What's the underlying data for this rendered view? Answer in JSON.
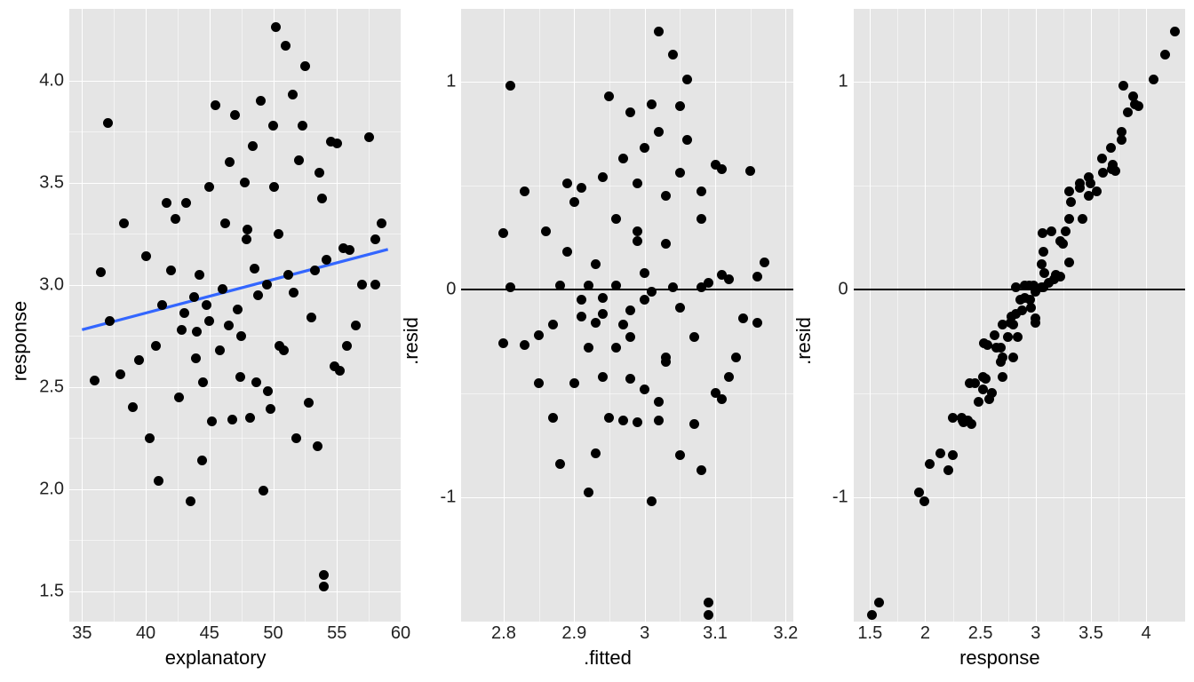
{
  "chart_data": [
    {
      "type": "scatter",
      "xlabel": "explanatory",
      "ylabel": "response",
      "xlim": [
        34,
        60
      ],
      "ylim": [
        1.35,
        4.35
      ],
      "xticks": [
        35,
        40,
        45,
        50,
        55,
        60
      ],
      "yticks": [
        1.5,
        2.0,
        2.5,
        3.0,
        3.5,
        4.0
      ],
      "regression": {
        "slope": 0.0164,
        "intercept": 2.205,
        "x0": 35,
        "x1": 59
      },
      "points": [
        [
          36.0,
          2.53
        ],
        [
          36.5,
          3.06
        ],
        [
          37.0,
          3.79
        ],
        [
          37.2,
          2.82
        ],
        [
          38.0,
          2.56
        ],
        [
          38.3,
          3.3
        ],
        [
          39.5,
          2.63
        ],
        [
          40.0,
          3.14
        ],
        [
          40.3,
          2.25
        ],
        [
          40.8,
          2.7
        ],
        [
          41.0,
          2.04
        ],
        [
          41.3,
          2.9
        ],
        [
          42.0,
          3.07
        ],
        [
          42.3,
          3.32
        ],
        [
          42.6,
          2.45
        ],
        [
          42.8,
          2.78
        ],
        [
          43.0,
          2.86
        ],
        [
          43.2,
          3.4
        ],
        [
          43.5,
          1.94
        ],
        [
          43.8,
          2.94
        ],
        [
          44.0,
          2.77
        ],
        [
          44.2,
          3.05
        ],
        [
          44.5,
          2.52
        ],
        [
          44.8,
          2.9
        ],
        [
          45.0,
          3.48
        ],
        [
          45.2,
          2.33
        ],
        [
          45.5,
          3.88
        ],
        [
          45.8,
          2.68
        ],
        [
          46.0,
          2.98
        ],
        [
          46.2,
          3.3
        ],
        [
          46.5,
          2.8
        ],
        [
          46.8,
          2.34
        ],
        [
          47.0,
          3.83
        ],
        [
          47.2,
          2.88
        ],
        [
          47.5,
          2.75
        ],
        [
          47.8,
          3.5
        ],
        [
          48.0,
          3.27
        ],
        [
          48.2,
          2.35
        ],
        [
          48.5,
          3.08
        ],
        [
          48.8,
          2.95
        ],
        [
          49.0,
          3.9
        ],
        [
          49.2,
          1.99
        ],
        [
          49.5,
          3.0
        ],
        [
          49.8,
          2.39
        ],
        [
          50.0,
          3.78
        ],
        [
          50.2,
          4.26
        ],
        [
          50.5,
          2.7
        ],
        [
          50.8,
          2.68
        ],
        [
          51.0,
          4.17
        ],
        [
          51.2,
          3.05
        ],
        [
          51.5,
          3.93
        ],
        [
          51.8,
          2.25
        ],
        [
          52.0,
          3.61
        ],
        [
          52.3,
          3.78
        ],
        [
          52.5,
          4.07
        ],
        [
          52.8,
          2.42
        ],
        [
          53.0,
          2.84
        ],
        [
          53.3,
          3.07
        ],
        [
          53.5,
          2.21
        ],
        [
          53.8,
          3.42
        ],
        [
          54.0,
          1.58
        ],
        [
          54.0,
          1.52
        ],
        [
          54.2,
          3.12
        ],
        [
          54.5,
          3.7
        ],
        [
          54.8,
          2.6
        ],
        [
          55.0,
          3.69
        ],
        [
          55.2,
          2.58
        ],
        [
          55.5,
          3.18
        ],
        [
          55.8,
          2.7
        ],
        [
          56.0,
          3.17
        ],
        [
          56.5,
          2.8
        ],
        [
          57.0,
          3.0
        ],
        [
          57.5,
          3.72
        ],
        [
          58.0,
          3.22
        ],
        [
          58.0,
          3.0
        ],
        [
          58.5,
          3.3
        ],
        [
          48.7,
          2.52
        ],
        [
          43.9,
          2.64
        ],
        [
          47.4,
          2.55
        ],
        [
          49.6,
          2.48
        ],
        [
          50.4,
          3.25
        ],
        [
          51.6,
          2.96
        ],
        [
          45.0,
          2.82
        ],
        [
          46.6,
          3.6
        ],
        [
          44.4,
          2.14
        ],
        [
          47.9,
          3.22
        ],
        [
          41.6,
          3.4
        ],
        [
          39.0,
          2.4
        ],
        [
          53.6,
          3.55
        ],
        [
          50.1,
          3.48
        ],
        [
          48.4,
          3.68
        ]
      ]
    },
    {
      "type": "scatter",
      "xlabel": ".fitted",
      "ylabel": ".resid",
      "xlim": [
        2.74,
        3.21
      ],
      "ylim": [
        -1.6,
        1.35
      ],
      "xticks": [
        2.8,
        2.9,
        3.0,
        3.1,
        3.2
      ],
      "yticks": [
        -1,
        0,
        1
      ],
      "hline": 0,
      "points": [
        [
          2.8,
          -0.26
        ],
        [
          2.8,
          0.27
        ],
        [
          2.81,
          0.98
        ],
        [
          2.81,
          0.01
        ],
        [
          2.83,
          -0.27
        ],
        [
          2.83,
          0.47
        ],
        [
          2.85,
          -0.22
        ],
        [
          2.86,
          0.28
        ],
        [
          2.87,
          -0.62
        ],
        [
          2.87,
          -0.17
        ],
        [
          2.88,
          -0.84
        ],
        [
          2.88,
          0.02
        ],
        [
          2.89,
          0.18
        ],
        [
          2.9,
          0.42
        ],
        [
          2.9,
          -0.45
        ],
        [
          2.91,
          -0.13
        ],
        [
          2.91,
          -0.05
        ],
        [
          2.91,
          0.49
        ],
        [
          2.92,
          -0.98
        ],
        [
          2.92,
          0.02
        ],
        [
          2.93,
          -0.16
        ],
        [
          2.93,
          0.12
        ],
        [
          2.94,
          -0.42
        ],
        [
          2.94,
          -0.04
        ],
        [
          2.94,
          0.54
        ],
        [
          2.95,
          -0.62
        ],
        [
          2.95,
          0.93
        ],
        [
          2.96,
          -0.28
        ],
        [
          2.96,
          0.02
        ],
        [
          2.96,
          0.34
        ],
        [
          2.97,
          -0.17
        ],
        [
          2.97,
          -0.63
        ],
        [
          2.98,
          0.85
        ],
        [
          2.98,
          -0.1
        ],
        [
          2.98,
          -0.23
        ],
        [
          2.99,
          0.51
        ],
        [
          2.99,
          0.28
        ],
        [
          2.99,
          -0.64
        ],
        [
          3.0,
          0.08
        ],
        [
          3.0,
          -0.05
        ],
        [
          3.01,
          0.89
        ],
        [
          3.01,
          -1.02
        ],
        [
          3.01,
          -0.01
        ],
        [
          3.02,
          -0.63
        ],
        [
          3.02,
          0.76
        ],
        [
          3.02,
          1.24
        ],
        [
          3.03,
          -0.33
        ],
        [
          3.03,
          -0.35
        ],
        [
          3.04,
          1.13
        ],
        [
          3.04,
          0.01
        ],
        [
          3.05,
          0.88
        ],
        [
          3.05,
          -0.8
        ],
        [
          3.05,
          0.56
        ],
        [
          3.06,
          0.72
        ],
        [
          3.06,
          1.01
        ],
        [
          3.07,
          -0.65
        ],
        [
          3.07,
          -0.23
        ],
        [
          3.08,
          0.01
        ],
        [
          3.08,
          -0.87
        ],
        [
          3.08,
          0.34
        ],
        [
          3.09,
          -1.51
        ],
        [
          3.09,
          -1.57
        ],
        [
          3.09,
          0.03
        ],
        [
          3.1,
          0.6
        ],
        [
          3.1,
          -0.5
        ],
        [
          3.11,
          0.58
        ],
        [
          3.11,
          -0.53
        ],
        [
          3.11,
          0.07
        ],
        [
          3.12,
          -0.42
        ],
        [
          3.12,
          0.05
        ],
        [
          3.13,
          -0.33
        ],
        [
          3.14,
          -0.14
        ],
        [
          3.15,
          0.57
        ],
        [
          3.16,
          0.06
        ],
        [
          3.16,
          -0.16
        ],
        [
          3.17,
          0.13
        ],
        [
          3.0,
          -0.48
        ],
        [
          2.92,
          -0.28
        ],
        [
          2.98,
          -0.43
        ],
        [
          3.02,
          -0.54
        ],
        [
          3.03,
          0.22
        ],
        [
          3.05,
          -0.09
        ],
        [
          2.94,
          -0.12
        ],
        [
          2.97,
          0.63
        ],
        [
          2.93,
          -0.79
        ],
        [
          2.99,
          0.23
        ],
        [
          2.89,
          0.51
        ],
        [
          2.85,
          -0.45
        ],
        [
          3.08,
          0.47
        ],
        [
          3.03,
          0.45
        ],
        [
          3.0,
          0.68
        ]
      ]
    },
    {
      "type": "scatter",
      "xlabel": "response",
      "ylabel": ".resid",
      "xlim": [
        1.35,
        4.35
      ],
      "ylim": [
        -1.6,
        1.35
      ],
      "xticks": [
        1.5,
        2.0,
        2.5,
        3.0,
        3.5,
        4.0
      ],
      "yticks": [
        -1,
        0,
        1
      ],
      "hline": 0,
      "points": [
        [
          1.52,
          -1.57
        ],
        [
          1.58,
          -1.51
        ],
        [
          1.94,
          -0.98
        ],
        [
          1.99,
          -1.02
        ],
        [
          2.04,
          -0.84
        ],
        [
          2.14,
          -0.79
        ],
        [
          2.21,
          -0.87
        ],
        [
          2.25,
          -0.8
        ],
        [
          2.25,
          -0.62
        ],
        [
          2.33,
          -0.62
        ],
        [
          2.34,
          -0.63
        ],
        [
          2.35,
          -0.64
        ],
        [
          2.39,
          -0.63
        ],
        [
          2.4,
          -0.45
        ],
        [
          2.42,
          -0.65
        ],
        [
          2.45,
          -0.45
        ],
        [
          2.48,
          -0.54
        ],
        [
          2.52,
          -0.48
        ],
        [
          2.52,
          -0.42
        ],
        [
          2.53,
          -0.26
        ],
        [
          2.55,
          -0.43
        ],
        [
          2.56,
          -0.27
        ],
        [
          2.58,
          -0.53
        ],
        [
          2.6,
          -0.5
        ],
        [
          2.63,
          -0.22
        ],
        [
          2.64,
          -0.28
        ],
        [
          2.68,
          -0.28
        ],
        [
          2.68,
          -0.35
        ],
        [
          2.7,
          -0.17
        ],
        [
          2.7,
          -0.33
        ],
        [
          2.7,
          -0.42
        ],
        [
          2.75,
          -0.23
        ],
        [
          2.77,
          -0.16
        ],
        [
          2.78,
          -0.13
        ],
        [
          2.8,
          -0.17
        ],
        [
          2.8,
          -0.33
        ],
        [
          2.82,
          0.01
        ],
        [
          2.82,
          -0.12
        ],
        [
          2.84,
          -0.23
        ],
        [
          2.86,
          -0.05
        ],
        [
          2.88,
          -0.1
        ],
        [
          2.9,
          0.02
        ],
        [
          2.9,
          -0.04
        ],
        [
          2.94,
          0.02
        ],
        [
          2.95,
          -0.05
        ],
        [
          2.96,
          -0.09
        ],
        [
          2.98,
          0.02
        ],
        [
          3.0,
          -0.01
        ],
        [
          3.0,
          -0.14
        ],
        [
          3.0,
          -0.16
        ],
        [
          3.05,
          0.12
        ],
        [
          3.05,
          0.01
        ],
        [
          3.06,
          0.27
        ],
        [
          3.07,
          0.18
        ],
        [
          3.07,
          0.01
        ],
        [
          3.08,
          0.08
        ],
        [
          3.12,
          0.03
        ],
        [
          3.14,
          0.28
        ],
        [
          3.17,
          0.05
        ],
        [
          3.18,
          0.07
        ],
        [
          3.22,
          0.06
        ],
        [
          3.22,
          0.23
        ],
        [
          3.25,
          0.22
        ],
        [
          3.27,
          0.28
        ],
        [
          3.3,
          0.47
        ],
        [
          3.3,
          0.13
        ],
        [
          3.3,
          0.34
        ],
        [
          3.32,
          0.42
        ],
        [
          3.4,
          0.49
        ],
        [
          3.4,
          0.51
        ],
        [
          3.42,
          0.34
        ],
        [
          3.48,
          0.54
        ],
        [
          3.48,
          0.45
        ],
        [
          3.5,
          0.51
        ],
        [
          3.55,
          0.47
        ],
        [
          3.6,
          0.63
        ],
        [
          3.61,
          0.56
        ],
        [
          3.68,
          0.68
        ],
        [
          3.69,
          0.58
        ],
        [
          3.7,
          0.6
        ],
        [
          3.72,
          0.57
        ],
        [
          3.78,
          0.76
        ],
        [
          3.78,
          0.72
        ],
        [
          3.79,
          0.98
        ],
        [
          3.83,
          0.85
        ],
        [
          3.88,
          0.93
        ],
        [
          3.9,
          0.89
        ],
        [
          3.93,
          0.88
        ],
        [
          4.07,
          1.01
        ],
        [
          4.17,
          1.13
        ],
        [
          4.26,
          1.24
        ]
      ]
    }
  ]
}
